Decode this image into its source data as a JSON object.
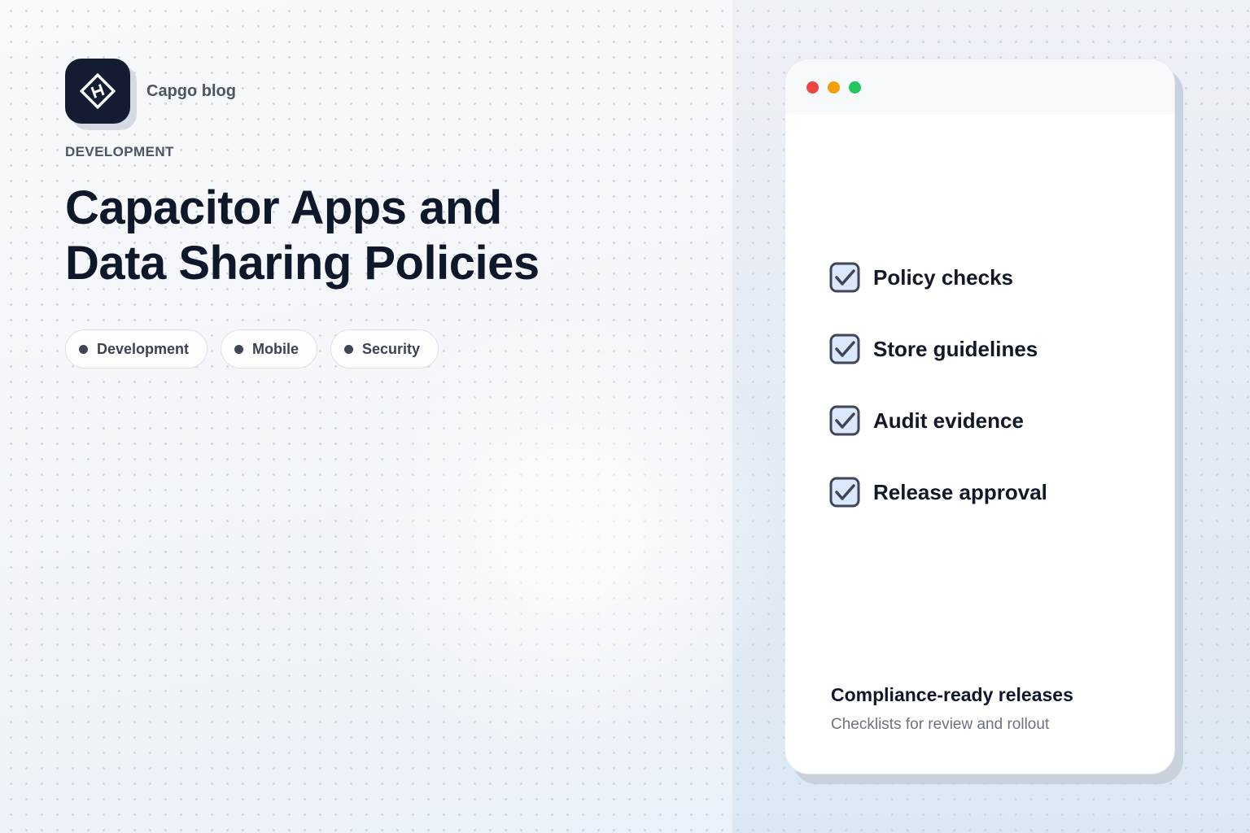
{
  "brand": {
    "name": "Capgo blog",
    "logo_icon": "diamond-logo-icon"
  },
  "category": "DEVELOPMENT",
  "title": {
    "line1": "Capacitor Apps and",
    "line2": "Data Sharing Policies"
  },
  "tags": [
    {
      "label": "Development"
    },
    {
      "label": "Mobile"
    },
    {
      "label": "Security"
    }
  ],
  "card": {
    "window_dots": [
      "#ef4444",
      "#f59e0b",
      "#22c55e"
    ],
    "checklist": [
      {
        "label": "Policy checks",
        "checked": true
      },
      {
        "label": "Store guidelines",
        "checked": true
      },
      {
        "label": "Audit evidence",
        "checked": true
      },
      {
        "label": "Release approval",
        "checked": true
      }
    ],
    "footer": {
      "title": "Compliance-ready releases",
      "subtitle": "Checklists for review and rollout"
    }
  },
  "colors": {
    "accent_dark": "#141c33",
    "checkbox_fill": "#dbe7fb",
    "checkbox_stroke": "#3f4657"
  }
}
